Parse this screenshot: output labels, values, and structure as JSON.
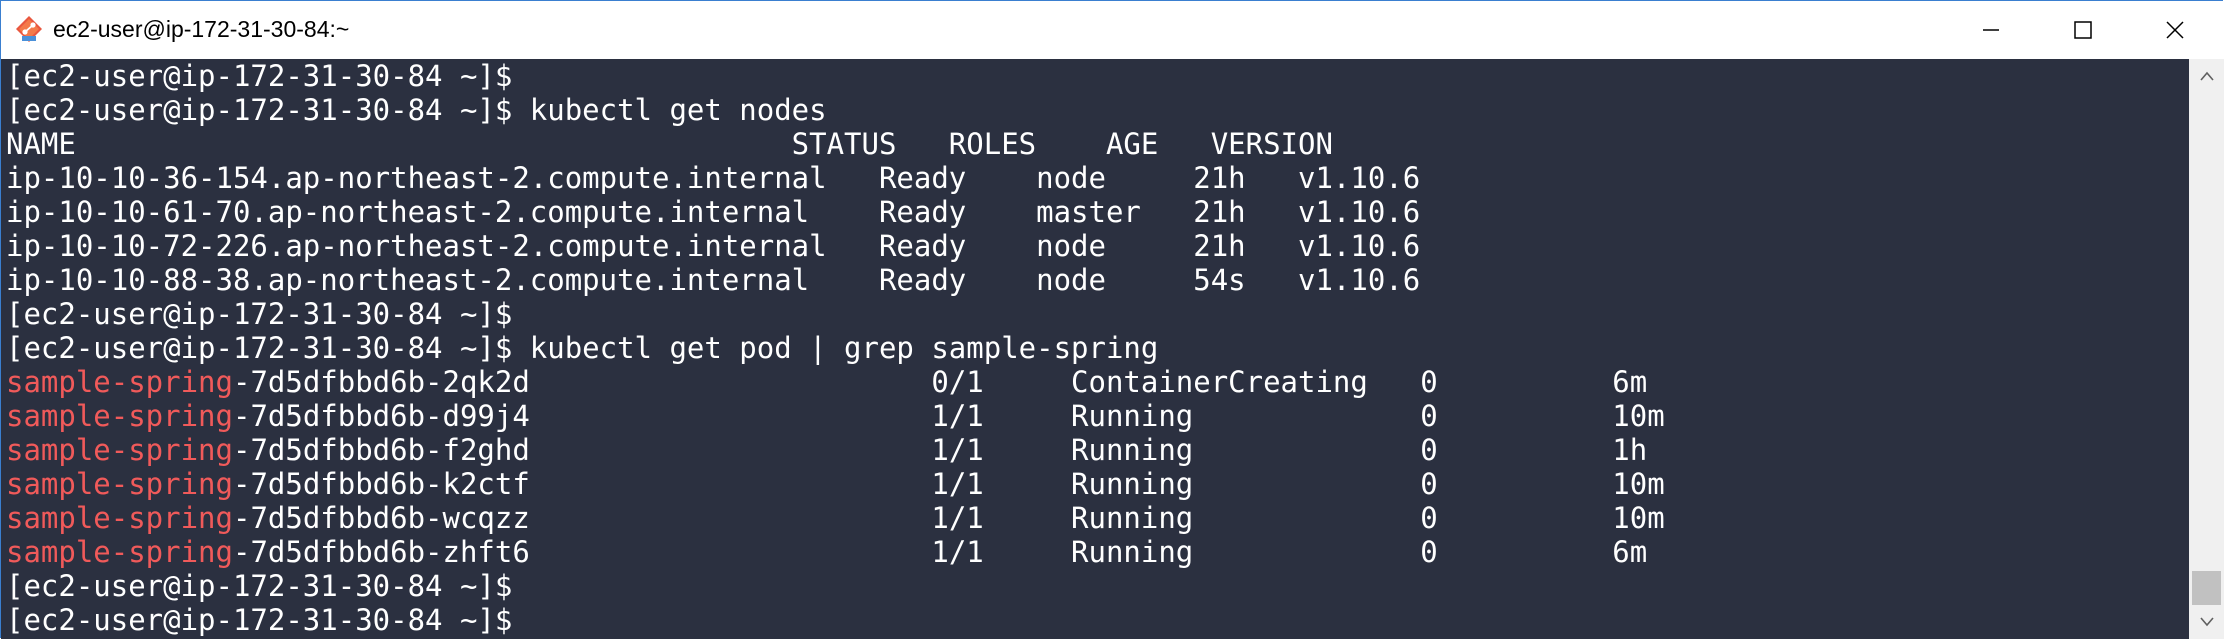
{
  "window": {
    "title": "ec2-user@ip-172-31-30-84:~",
    "icon": "git-bash-icon",
    "colors": {
      "terminal_bg": "#2b3040",
      "text": "#ffffff",
      "highlight_red": "#f05a5a"
    }
  },
  "terminal": {
    "lines": [
      {
        "text": "[ec2-user@ip-172-31-30-84 ~]$"
      },
      {
        "text": "[ec2-user@ip-172-31-30-84 ~]$ kubectl get nodes"
      },
      {
        "text": "NAME                                         STATUS   ROLES    AGE   VERSION"
      },
      {
        "text": "ip-10-10-36-154.ap-northeast-2.compute.internal   Ready    node     21h   v1.10.6"
      },
      {
        "text": "ip-10-10-61-70.ap-northeast-2.compute.internal    Ready    master   21h   v1.10.6"
      },
      {
        "text": "ip-10-10-72-226.ap-northeast-2.compute.internal   Ready    node     21h   v1.10.6"
      },
      {
        "text": "ip-10-10-88-38.ap-northeast-2.compute.internal    Ready    node     54s   v1.10.6"
      },
      {
        "text": "[ec2-user@ip-172-31-30-84 ~]$"
      },
      {
        "text": "[ec2-user@ip-172-31-30-84 ~]$ kubectl get pod | grep sample-spring"
      },
      {
        "highlight": "sample-spring",
        "rest": "-7d5dfbbd6b-2qk2d                       0/1     ContainerCreating   0          6m"
      },
      {
        "highlight": "sample-spring",
        "rest": "-7d5dfbbd6b-d99j4                       1/1     Running             0          10m"
      },
      {
        "highlight": "sample-spring",
        "rest": "-7d5dfbbd6b-f2ghd                       1/1     Running             0          1h"
      },
      {
        "highlight": "sample-spring",
        "rest": "-7d5dfbbd6b-k2ctf                       1/1     Running             0          10m"
      },
      {
        "highlight": "sample-spring",
        "rest": "-7d5dfbbd6b-wcqzz                       1/1     Running             0          10m"
      },
      {
        "highlight": "sample-spring",
        "rest": "-7d5dfbbd6b-zhft6                       1/1     Running             0          6m"
      },
      {
        "text": "[ec2-user@ip-172-31-30-84 ~]$"
      },
      {
        "text": "[ec2-user@ip-172-31-30-84 ~]$"
      }
    ]
  }
}
